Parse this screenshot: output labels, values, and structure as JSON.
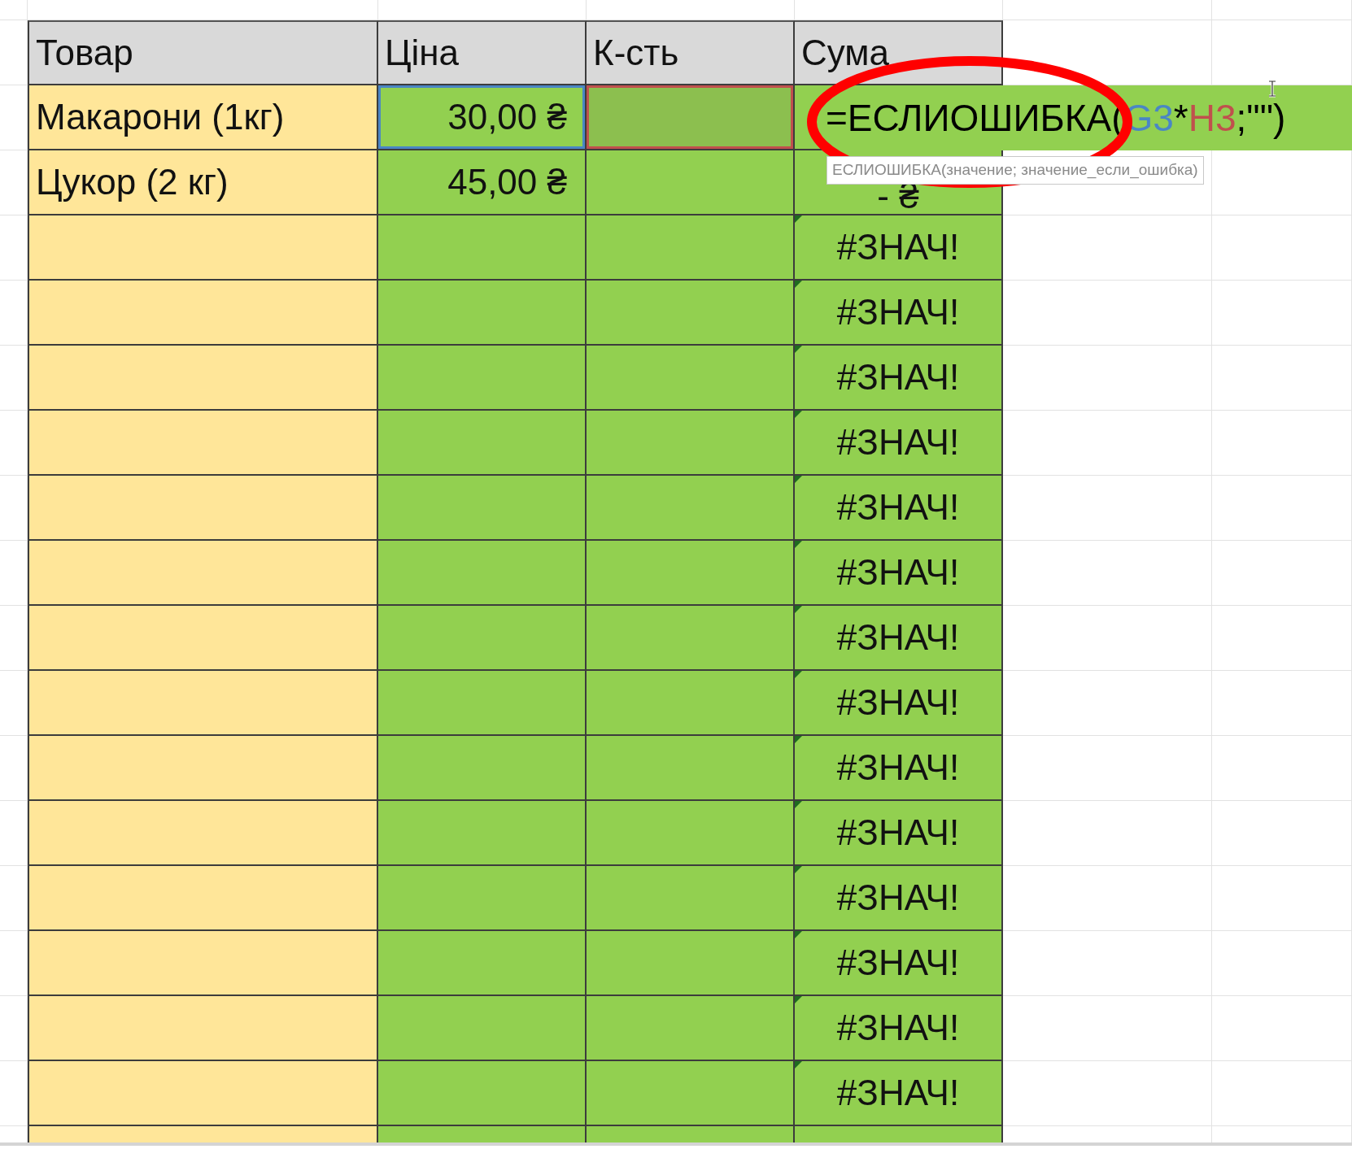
{
  "columns": [
    "Товар",
    "Ціна",
    "К-сть",
    "Сума"
  ],
  "rows": [
    {
      "product": "Макарони (1кг)",
      "price": "30,00 ₴",
      "price_ref": {
        "color": "#4a86c5"
      },
      "qty_ref": {
        "color": "#c0504d"
      },
      "editing": true
    },
    {
      "product": "Цукор (2 кг)",
      "price": "45,00 ₴",
      "sum": "-  ₴",
      "error": false
    },
    {
      "sum": "#ЗНАЧ!",
      "error": true
    },
    {
      "sum": "#ЗНАЧ!",
      "error": true
    },
    {
      "sum": "#ЗНАЧ!",
      "error": true
    },
    {
      "sum": "#ЗНАЧ!",
      "error": true
    },
    {
      "sum": "#ЗНАЧ!",
      "error": true
    },
    {
      "sum": "#ЗНАЧ!",
      "error": true
    },
    {
      "sum": "#ЗНАЧ!",
      "error": true
    },
    {
      "sum": "#ЗНАЧ!",
      "error": true
    },
    {
      "sum": "#ЗНАЧ!",
      "error": true
    },
    {
      "sum": "#ЗНАЧ!",
      "error": true
    },
    {
      "sum": "#ЗНАЧ!",
      "error": true
    },
    {
      "sum": "#ЗНАЧ!",
      "error": true
    },
    {
      "sum": "#ЗНАЧ!",
      "error": true
    },
    {
      "sum": "#ЗНАЧ!",
      "error": true
    }
  ],
  "formula": {
    "parts": [
      {
        "text": "=ЕСЛИОШИБКА(",
        "color": "#000000"
      },
      {
        "text": "G3",
        "color": "#4a86c5"
      },
      {
        "text": "*",
        "color": "#000000"
      },
      {
        "text": "H3",
        "color": "#c0504d"
      },
      {
        "text": ";\"\")",
        "color": "#000000"
      }
    ],
    "tooltip": "ЕСЛИОШИБКА(значение; значение_если_ошибка)"
  },
  "annotation": {
    "kind": "ellipse",
    "color": "#ff0000"
  }
}
